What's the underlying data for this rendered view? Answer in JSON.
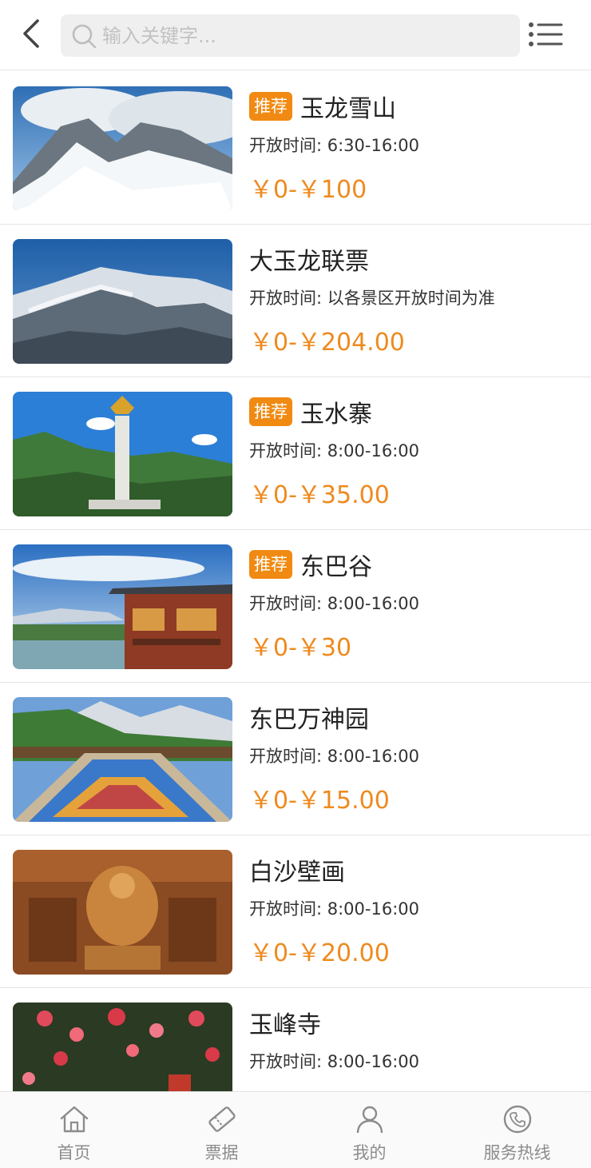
{
  "header": {
    "search_placeholder": "输入关键字..."
  },
  "items": [
    {
      "badge": "推荐",
      "title": "玉龙雪山",
      "hours": "开放时间: 6:30-16:00",
      "price": "￥0-￥100"
    },
    {
      "badge": "",
      "title": "大玉龙联票",
      "hours": "开放时间: 以各景区开放时间为准",
      "price": "￥0-￥204.00"
    },
    {
      "badge": "推荐",
      "title": "玉水寨",
      "hours": "开放时间: 8:00-16:00",
      "price": "￥0-￥35.00"
    },
    {
      "badge": "推荐",
      "title": "东巴谷",
      "hours": "开放时间: 8:00-16:00",
      "price": "￥0-￥30"
    },
    {
      "badge": "",
      "title": "东巴万神园",
      "hours": "开放时间: 8:00-16:00",
      "price": "￥0-￥15.00"
    },
    {
      "badge": "",
      "title": "白沙壁画",
      "hours": "开放时间: 8:00-16:00",
      "price": "￥0-￥20.00"
    },
    {
      "badge": "",
      "title": "玉峰寺",
      "hours": "开放时间: 8:00-16:00",
      "price": ""
    }
  ],
  "tabbar": {
    "tabs": [
      {
        "label": "首页",
        "icon": "home-icon"
      },
      {
        "label": "票据",
        "icon": "ticket-icon"
      },
      {
        "label": "我的",
        "icon": "user-icon"
      },
      {
        "label": "服务热线",
        "icon": "phone-icon"
      }
    ]
  },
  "colors": {
    "accent": "#f08a12",
    "price": "#ee8a1e"
  }
}
